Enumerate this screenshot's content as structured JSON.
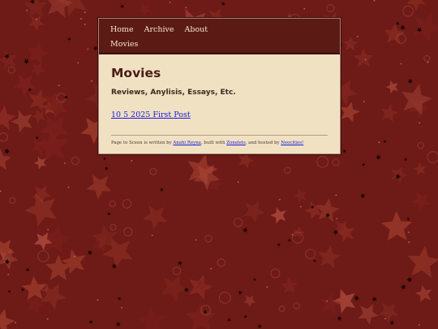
{
  "nav": {
    "items": [
      {
        "label": "Home"
      },
      {
        "label": "Archive"
      },
      {
        "label": "About"
      },
      {
        "label": "Movies"
      }
    ]
  },
  "main": {
    "title": "Movies",
    "subtitle": "Reviews, Anylisis, Essays, Etc.",
    "post_link": "10 5 2025 First Post"
  },
  "footer": {
    "prefix": "Page to Sceen is written by ",
    "author": "Anahi Reyna",
    "mid1": ", built with ",
    "tool": "Zonelets",
    "mid2": ", and hosted by ",
    "host": "Neocities!"
  },
  "colors": {
    "background": "#6e1a17",
    "nav_background": "#5c1a14",
    "content_background": "#f0e1c2",
    "link": "#1a1ae0",
    "title": "#4a1d15"
  }
}
